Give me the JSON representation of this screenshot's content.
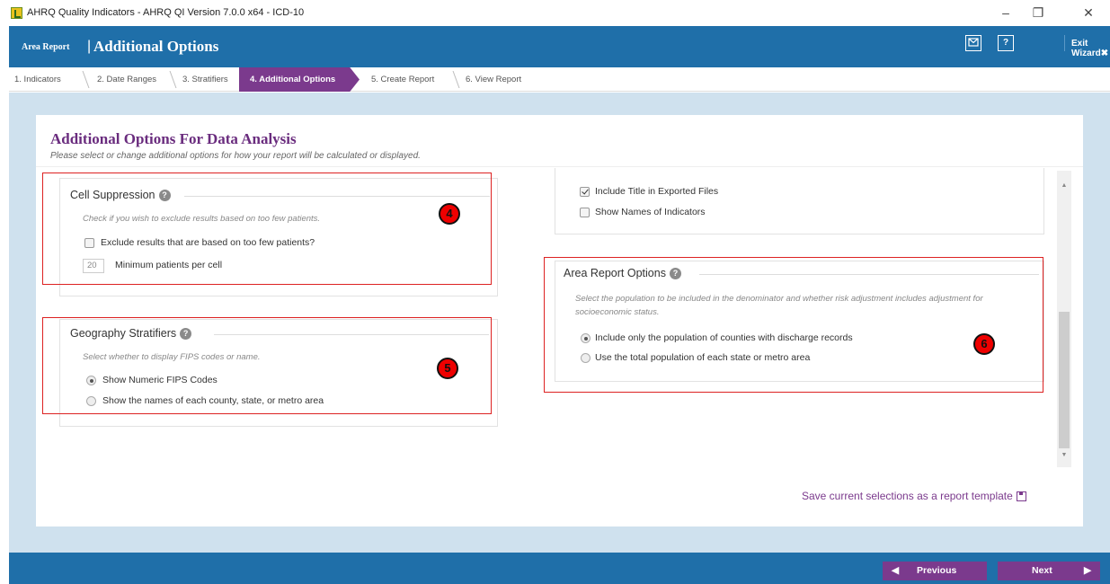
{
  "window": {
    "title": "AHRQ Quality Indicators - AHRQ QI Version 7.0.0 x64 - ICD-10",
    "controls": [
      "minimize",
      "restore",
      "close"
    ]
  },
  "header": {
    "section": "Area Report",
    "separator": "|",
    "title": "Additional Options",
    "mail_icon": "mail-icon",
    "help_label": "?",
    "exit_label": "Exit Wizard",
    "exit_icon": "✖",
    "color": "#1f6fa9"
  },
  "steps": [
    {
      "label": "1. Indicators",
      "active": false
    },
    {
      "label": "2. Date Ranges",
      "active": false
    },
    {
      "label": "3. Stratifiers",
      "active": false
    },
    {
      "label": "4. Additional Options",
      "active": true
    },
    {
      "label": "5. Create Report",
      "active": false
    },
    {
      "label": "6. View Report",
      "active": false
    }
  ],
  "page": {
    "title": "Additional Options For Data Analysis",
    "subtitle": "Please select or change additional options for how your report will be calculated or displayed."
  },
  "cell_suppression": {
    "title": "Cell Suppression",
    "description": "Check if you wish to exclude results based on too few patients.",
    "exclude_label": "Exclude results that are based on too few patients?",
    "exclude_checked": false,
    "min_value": "20",
    "min_label": "Minimum patients per cell"
  },
  "geography": {
    "title": "Geography Stratifiers",
    "description": "Select whether to display FIPS codes or name.",
    "options": [
      {
        "label": "Show Numeric FIPS Codes",
        "checked": true
      },
      {
        "label": "Show the names of each county, state, or metro area",
        "checked": false
      }
    ]
  },
  "display": {
    "include_title_label": "Include Title in Exported Files",
    "include_title_checked": true,
    "show_names_label": "Show Names of Indicators",
    "show_names_checked": false
  },
  "area_report": {
    "title": "Area Report Options",
    "description": "Select the population to be included in the denominator and whether risk adjustment includes adjustment for socioeconomic status.",
    "options": [
      {
        "label": "Include only the population of counties with discharge records",
        "checked": true
      },
      {
        "label": "Use the total population of each state or metro area",
        "checked": false
      }
    ]
  },
  "markers": [
    "4",
    "5",
    "6"
  ],
  "save_link": "Save current selections as a report template",
  "footer": {
    "previous_label": "Previous",
    "next_label": "Next",
    "accent_color": "#7b3a8d"
  },
  "colors": {
    "brand_purple": "#7b3a8d",
    "header_blue": "#1f6fa9",
    "page_bg": "#cfe1ee",
    "highlight_red": "#d22222"
  }
}
